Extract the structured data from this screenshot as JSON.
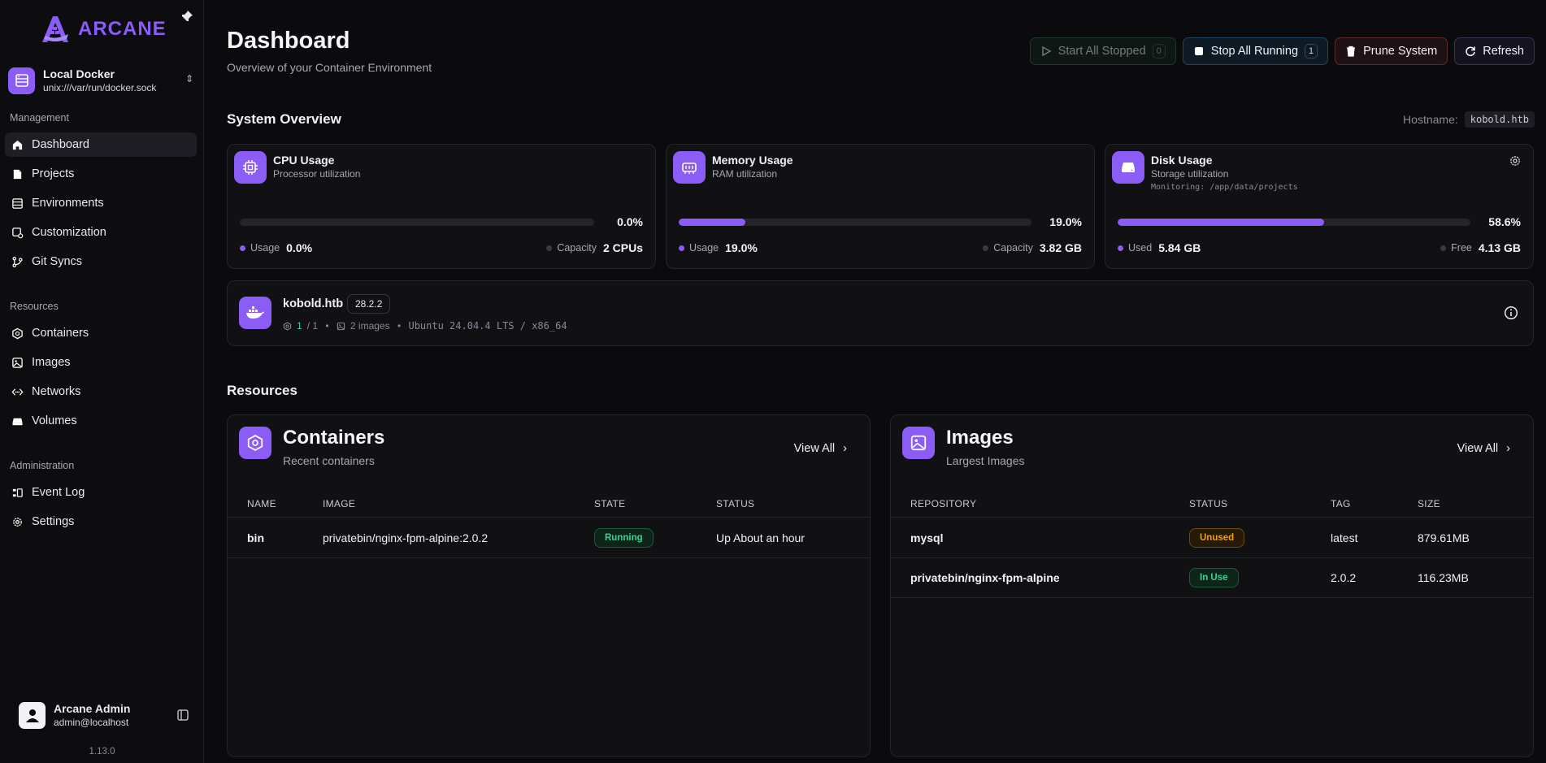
{
  "sidebar": {
    "logo_text": "ARCANE",
    "environment": {
      "name": "Local Docker",
      "socket": "unix:///var/run/docker.sock"
    },
    "sections": [
      {
        "heading": "Management",
        "items": [
          {
            "label": "Dashboard",
            "icon": "home-icon",
            "active": true
          },
          {
            "label": "Projects",
            "icon": "file-icon"
          },
          {
            "label": "Environments",
            "icon": "server-icon"
          },
          {
            "label": "Customization",
            "icon": "customize-icon"
          },
          {
            "label": "Git Syncs",
            "icon": "git-icon"
          }
        ]
      },
      {
        "heading": "Resources",
        "items": [
          {
            "label": "Containers",
            "icon": "hexagon-icon"
          },
          {
            "label": "Images",
            "icon": "image-icon"
          },
          {
            "label": "Networks",
            "icon": "network-icon"
          },
          {
            "label": "Volumes",
            "icon": "volume-icon"
          }
        ]
      },
      {
        "heading": "Administration",
        "items": [
          {
            "label": "Event Log",
            "icon": "event-log-icon"
          },
          {
            "label": "Settings",
            "icon": "gear-icon"
          }
        ]
      }
    ],
    "user": {
      "name": "Arcane Admin",
      "email": "admin@localhost"
    },
    "version": "1.13.0"
  },
  "header": {
    "title": "Dashboard",
    "subtitle": "Overview of your Container Environment",
    "actions": {
      "start_label": "Start All Stopped",
      "start_count": "0",
      "stop_label": "Stop All Running",
      "stop_count": "1",
      "prune_label": "Prune System",
      "refresh_label": "Refresh"
    }
  },
  "overview": {
    "title": "System Overview",
    "hostname_label": "Hostname:",
    "hostname": "kobold.htb",
    "cards": [
      {
        "title": "CPU Usage",
        "subtitle": "Processor utilization",
        "percent": 0.0,
        "percent_label": "0.0%",
        "left_label": "Usage",
        "left_value": "0.0%",
        "right_label": "Capacity",
        "right_value": "2 CPUs"
      },
      {
        "title": "Memory Usage",
        "subtitle": "RAM utilization",
        "percent": 19.0,
        "percent_label": "19.0%",
        "left_label": "Usage",
        "left_value": "19.0%",
        "right_label": "Capacity",
        "right_value": "3.82 GB"
      },
      {
        "title": "Disk Usage",
        "subtitle": "Storage utilization",
        "monitoring": "Monitoring: /app/data/projects",
        "percent": 58.6,
        "percent_label": "58.6%",
        "left_label": "Used",
        "left_value": "5.84 GB",
        "right_label": "Free",
        "right_value": "4.13 GB"
      }
    ],
    "host": {
      "name": "kobold.htb",
      "docker_version": "28.2.2",
      "containers_running": "1",
      "containers_total": "/ 1",
      "images": "2 images",
      "os": "Ubuntu 24.04.4 LTS / x86_64"
    }
  },
  "resources": {
    "title": "Resources",
    "containers": {
      "title": "Containers",
      "subtitle": "Recent containers",
      "view_all": "View All",
      "columns": [
        "NAME",
        "IMAGE",
        "STATE",
        "STATUS"
      ],
      "rows": [
        {
          "name": "bin",
          "image": "privatebin/nginx-fpm-alpine:2.0.2",
          "state": "Running",
          "status": "Up About an hour"
        }
      ]
    },
    "images": {
      "title": "Images",
      "subtitle": "Largest Images",
      "view_all": "View All",
      "columns": [
        "REPOSITORY",
        "STATUS",
        "TAG",
        "SIZE"
      ],
      "rows": [
        {
          "repository": "mysql",
          "status": "Unused",
          "tag": "latest",
          "size": "879.61MB"
        },
        {
          "repository": "privatebin/nginx-fpm-alpine",
          "status": "In Use",
          "tag": "2.0.2",
          "size": "116.23MB"
        }
      ]
    }
  },
  "colors": {
    "accent": "#8b5cf6",
    "success": "#34d399",
    "warning": "#f59e0b",
    "background": "#0b0b0d"
  }
}
